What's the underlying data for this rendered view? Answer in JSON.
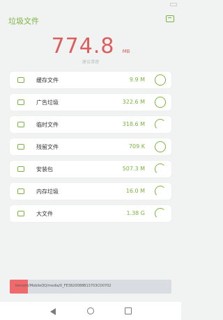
{
  "header": {
    "title": "垃圾文件"
  },
  "summary": {
    "size_value": "774.8",
    "size_unit": "MB",
    "suggestion": "建议清理"
  },
  "items": [
    {
      "label": "缓存文件",
      "size": "9.9 M",
      "icon": "cache-icon",
      "state": "checked"
    },
    {
      "label": "广告垃圾",
      "size": "322.6 M",
      "icon": "ad-icon",
      "state": "checked"
    },
    {
      "label": "临时文件",
      "size": "318.6 M",
      "icon": "temp-file-icon",
      "state": "scanning"
    },
    {
      "label": "残留文件",
      "size": "709 K",
      "icon": "residual-file-icon",
      "state": "checked"
    },
    {
      "label": "安装包",
      "size": "507.3 M",
      "icon": "package-icon",
      "state": "scanning"
    },
    {
      "label": "内存垃圾",
      "size": "16.0 M",
      "icon": "memory-icon",
      "state": "scanning"
    },
    {
      "label": "大文件",
      "size": "1.38 G",
      "icon": "large-file-icon",
      "state": "scanning"
    }
  ],
  "scan": {
    "path": "tencent/MobileQQ/media/0_FE3820088B13703CD0702",
    "progress": 0.11
  },
  "colors": {
    "accent": "#7bb23f",
    "size_red": "#dd5d5d",
    "background": "#f1f3f2",
    "progress_fill": "#ef6b6b"
  }
}
